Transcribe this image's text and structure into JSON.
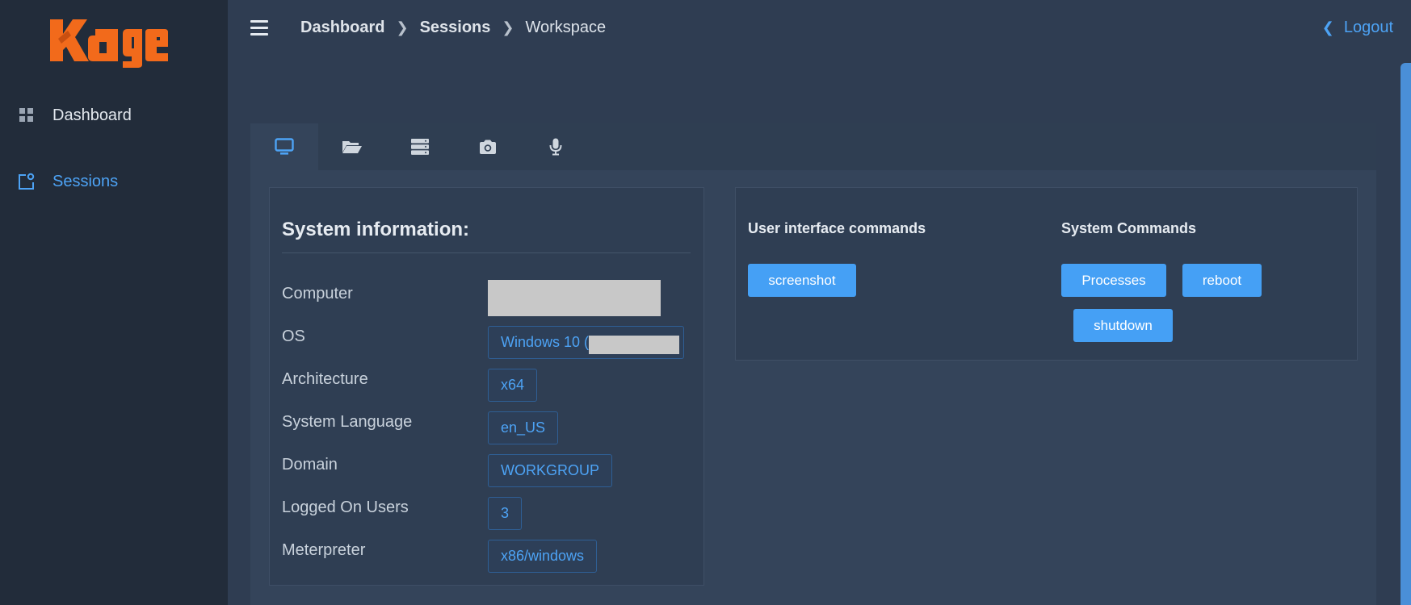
{
  "app": {
    "brand": "Kage",
    "brand_color": "#f26a1b",
    "accent": "#4da3f5"
  },
  "sidebar": {
    "items": [
      {
        "label": "Dashboard",
        "icon": "grid-icon",
        "active": false
      },
      {
        "label": "Sessions",
        "icon": "sessions-icon",
        "active": true
      }
    ]
  },
  "header": {
    "breadcrumbs": [
      "Dashboard",
      "Sessions",
      "Workspace"
    ],
    "logout_label": "Logout"
  },
  "tabs": [
    {
      "icon": "monitor-icon",
      "active": true
    },
    {
      "icon": "folder-open-icon",
      "active": false
    },
    {
      "icon": "server-icon",
      "active": false
    },
    {
      "icon": "camera-icon",
      "active": false
    },
    {
      "icon": "microphone-icon",
      "active": false
    }
  ],
  "system_info": {
    "title": "System information:",
    "rows": [
      {
        "label": "Computer",
        "value": ""
      },
      {
        "label": "OS",
        "value": "Windows 10 ("
      },
      {
        "label": "Architecture",
        "value": "x64"
      },
      {
        "label": "System Language",
        "value": "en_US"
      },
      {
        "label": "Domain",
        "value": "WORKGROUP"
      },
      {
        "label": "Logged On Users",
        "value": "3"
      },
      {
        "label": "Meterpreter",
        "value": "x86/windows"
      }
    ]
  },
  "commands": {
    "ui_title": "User interface commands",
    "ui_buttons": [
      "screenshot"
    ],
    "system_title": "System Commands",
    "system_buttons": [
      "Processes",
      "reboot",
      "shutdown"
    ]
  }
}
